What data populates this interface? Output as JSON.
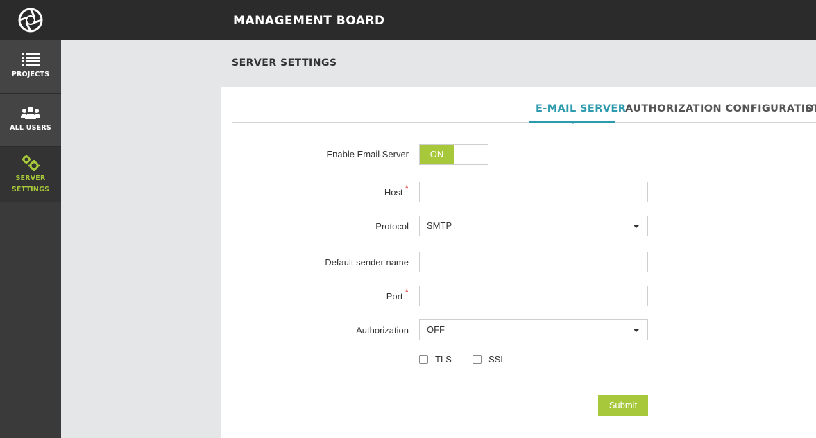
{
  "header": {
    "title": "MANAGEMENT BOARD"
  },
  "sidebar": {
    "items": [
      {
        "label": "PROJECTS",
        "icon": "list-icon"
      },
      {
        "label": "ALL USERS",
        "icon": "users-icon"
      },
      {
        "label_line1": "SERVER",
        "label_line2": "SETTINGS",
        "icon": "gears-icon",
        "active": true
      }
    ]
  },
  "page": {
    "title": "SERVER SETTINGS"
  },
  "tabs": [
    {
      "label": "E-MAIL SERVER",
      "active": true
    },
    {
      "label": "AUTHORIZATION CONFIGURATION"
    },
    {
      "label": "ST"
    }
  ],
  "form": {
    "enable_label": "Enable Email Server",
    "enable_value": "ON",
    "host_label": "Host",
    "host_value": "",
    "protocol_label": "Protocol",
    "protocol_value": "SMTP",
    "sender_label": "Default sender name",
    "sender_value": "",
    "port_label": "Port",
    "port_value": "",
    "auth_label": "Authorization",
    "auth_value": "OFF",
    "tls_label": "TLS",
    "ssl_label": "SSL",
    "required_mark": "*",
    "submit_label": "Submit"
  },
  "colors": {
    "accent_green": "#a7c83a",
    "accent_teal": "#2e9aad",
    "required": "#e53935"
  }
}
